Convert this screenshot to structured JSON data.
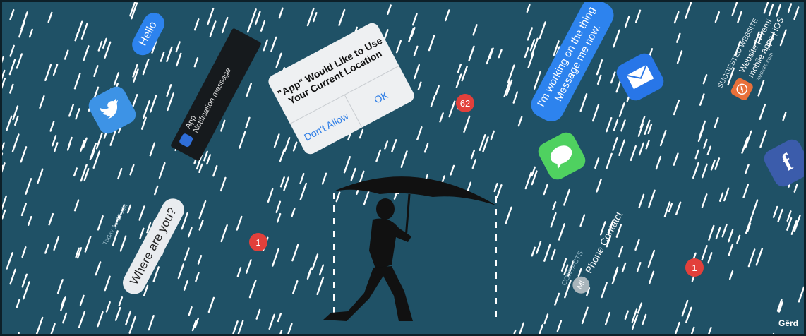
{
  "messages": {
    "hello": "Hello",
    "where": "Where are you?",
    "timestamp": "Today 10:17 AM",
    "working_line1": "I'm working on the thing",
    "working_line2": "Message me now."
  },
  "notification": {
    "app": "App",
    "message": "Notification message"
  },
  "alert": {
    "title_line1": "\"App\" Would Like to Use",
    "title_line2": "Your Current Location",
    "deny": "Don't Allow",
    "ok": "OK"
  },
  "badges": {
    "badge_62": "62",
    "badge_1a": "1",
    "badge_1b": "1"
  },
  "contacts": {
    "header": "CONTACTS",
    "initials": "MI",
    "name": "Phone Contatct"
  },
  "suggested": {
    "header": "SUGGESTED WEBSITE",
    "title": "Website | Premi",
    "subtitle": "mobile apps | iOS",
    "url": "website.com"
  },
  "signature": "Gērd",
  "icons": [
    "twitter-icon",
    "mail-icon",
    "messages-icon",
    "facebook-icon",
    "safari-icon"
  ],
  "colors": {
    "background": "#1f5166",
    "rain": "#ffffff",
    "bubble_blue": "#2d83ee",
    "badge_red": "#e2403b"
  }
}
